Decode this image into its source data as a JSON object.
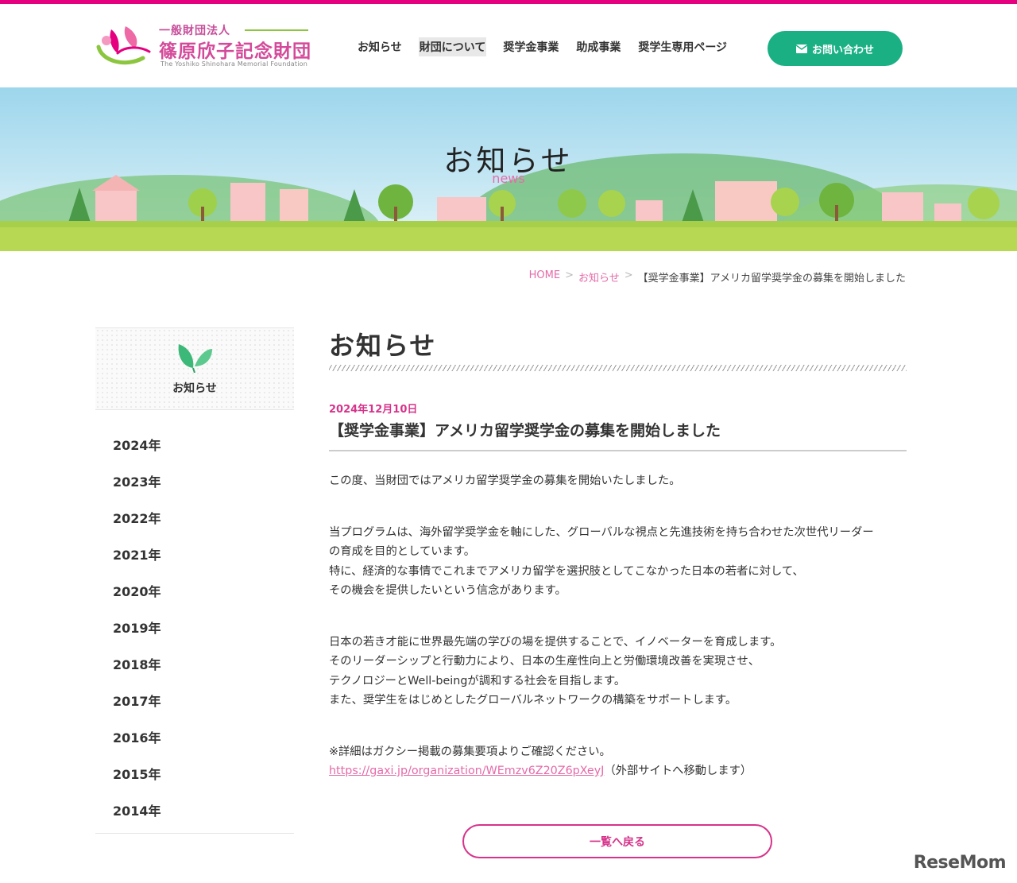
{
  "header": {
    "logo_small": "一般財団法人",
    "logo_big": "篠原欣子記念財団",
    "logo_en": "The Yoshiko Shinohara Memorial Foundation",
    "nav": [
      {
        "label": "お知らせ"
      },
      {
        "label": "財団について"
      },
      {
        "label": "奨学金事業"
      },
      {
        "label": "助成事業"
      },
      {
        "label": "奨学生専用ページ"
      }
    ],
    "contact_label": "お問い合わせ",
    "icon": "mail-icon"
  },
  "hero": {
    "title": "お知らせ",
    "subtitle": "news"
  },
  "breadcrumb": {
    "home": "HOME",
    "section": "お知らせ",
    "separator": ">",
    "current": "【奨学金事業】アメリカ留学奨学金の募集を開始しました"
  },
  "sidebar": {
    "icon": "leaf-icon",
    "heading": "お知らせ",
    "years": [
      "2024年",
      "2023年",
      "2022年",
      "2021年",
      "2020年",
      "2019年",
      "2018年",
      "2017年",
      "2016年",
      "2015年",
      "2014年"
    ]
  },
  "main": {
    "title": "お知らせ",
    "post_date": "2024年12月10日",
    "post_title": "【奨学金事業】アメリカ留学奨学金の募集を開始しました",
    "p1": "この度、当財団ではアメリカ留学奨学金の募集を開始いたしました。",
    "p2_l1": "当プログラムは、海外留学奨学金を軸にした、グローバルな視点と先進技術を持ち合わせた次世代リーダー",
    "p2_l2": "の育成を目的としています。",
    "p2_l3": "特に、経済的な事情でこれまでアメリカ留学を選択肢としてこなかった日本の若者に対して、",
    "p2_l4": "その機会を提供したいという信念があります。",
    "p3_l1": "日本の若き才能に世界最先端の学びの場を提供することで、イノベーターを育成します。",
    "p3_l2": "そのリーダーシップと行動力により、日本の生産性向上と労働環境改善を実現させ、",
    "p3_l3": "テクノロジーとWell-beingが調和する社会を目指します。",
    "p3_l4": "また、奨学生をはじめとしたグローバルネットワークの構築をサポートします。",
    "p4_l1": "※詳細はガクシー掲載の募集要項よりご確認ください。",
    "p4_link": "https://gaxi.jp/organization/WEmzv6Z20Z6pXeyJ",
    "p4_note": "（外部サイトへ移動します）",
    "back_label": "一覧へ戻る"
  },
  "watermark": "ReseMom",
  "colors": {
    "accent_pink": "#e4007f",
    "link_pink": "#e56aa8",
    "contact_green": "#1ab084"
  }
}
